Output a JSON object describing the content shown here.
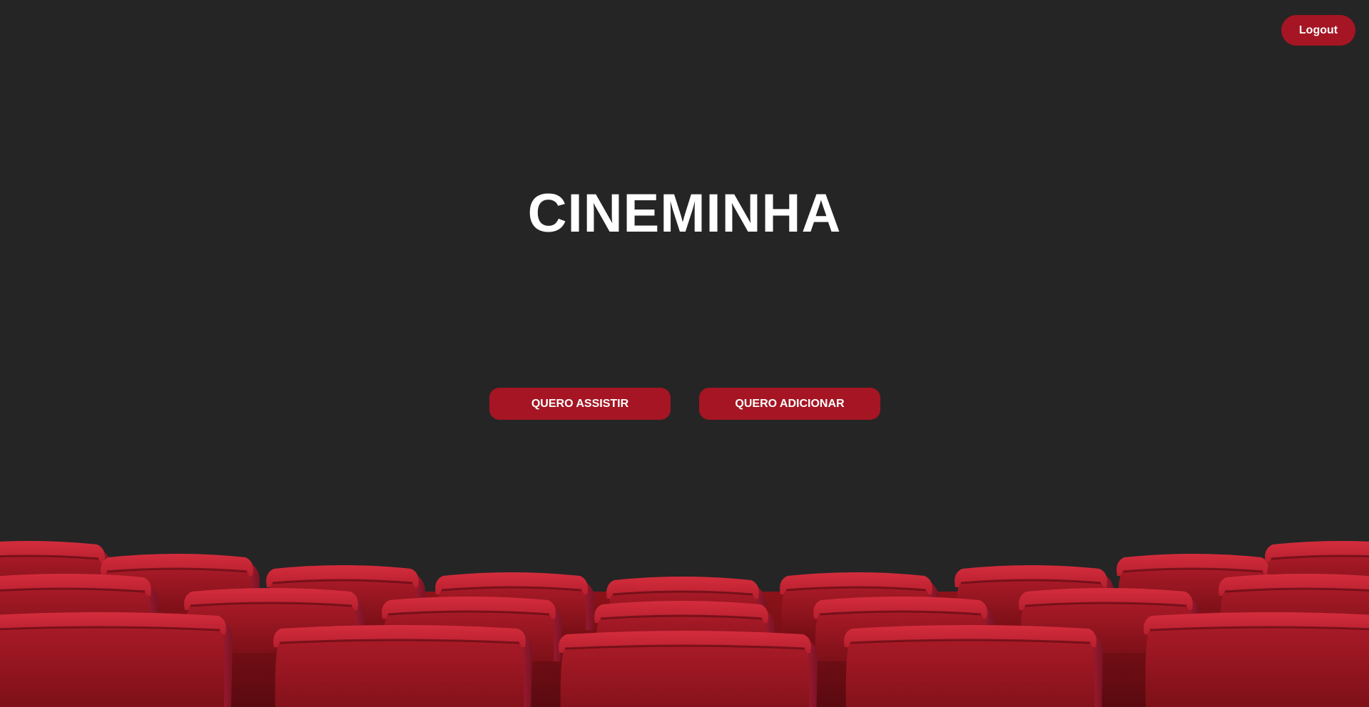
{
  "header": {
    "logout_label": "Logout"
  },
  "main": {
    "title": "CINEMINHA",
    "actions": {
      "watch_label": "QUERO ASSISTIR",
      "add_label": "QUERO ADICIONAR"
    }
  },
  "colors": {
    "background": "#252525",
    "accent": "#a51523",
    "text": "#ffffff",
    "seat_light": "#d02a3a",
    "seat_mid": "#b01c2b",
    "seat_dark": "#7a1018"
  }
}
